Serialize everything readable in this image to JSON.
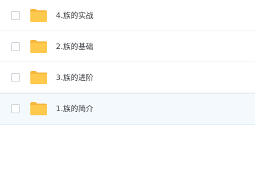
{
  "file_list": {
    "items": [
      {
        "name": "4.族的实战",
        "icon": "folder-icon",
        "checked": false
      },
      {
        "name": "2.族的基础",
        "icon": "folder-icon",
        "checked": false
      },
      {
        "name": "3.族的进阶",
        "icon": "folder-icon",
        "checked": false
      },
      {
        "name": "1.族的简介",
        "icon": "folder-icon",
        "checked": false,
        "hovered": true
      }
    ]
  },
  "colors": {
    "folder": "#ffc94d",
    "folder_tab": "#f6b73c",
    "hover_row": "#f4f9fd",
    "text": "#3c3f44"
  }
}
